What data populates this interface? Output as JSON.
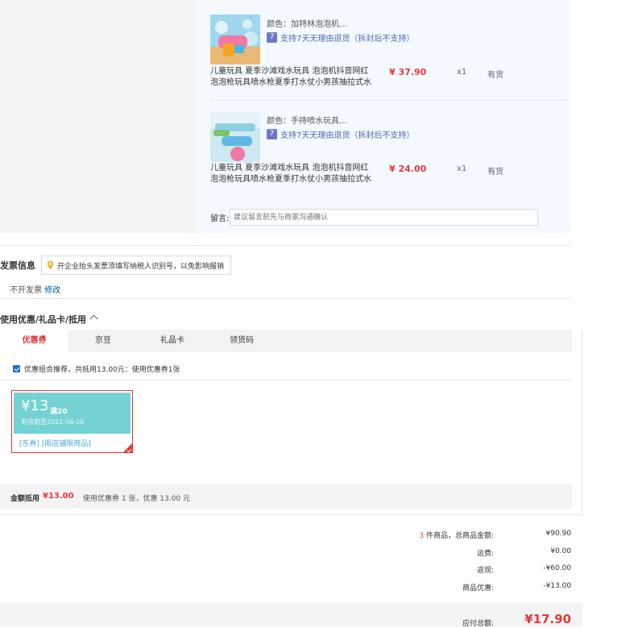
{
  "order_items": [
    {
      "attr": "颜色：加特林泡泡机...",
      "service": "支持7天无理由退货（拆封后不支持）",
      "title_line1": "儿童玩具 夏季沙滩戏水玩具 泡泡机抖音网红",
      "title_line2": "泡泡枪玩具喷水枪夏季打水仗小男孩抽拉式水",
      "price": "¥ 37.90",
      "qty": "x1",
      "stock": "有货"
    },
    {
      "attr": "颜色：手持喷水玩具...",
      "service": "支持7天无理由退货（拆封后不支持）",
      "title_line1": "儿童玩具 夏季沙滩戏水玩具 泡泡机抖音网红",
      "title_line2": "泡泡枪玩具喷水枪夏季打水仗小男孩抽拉式水",
      "price": "¥ 24.00",
      "qty": "x1",
      "stock": "有货"
    }
  ],
  "remark": {
    "label": "留言:",
    "placeholder": "建议留言前先与商家沟通确认"
  },
  "invoice": {
    "title": "发票信息",
    "tip": "开企业抬头发票须填写纳税人识别号，以免影响报销",
    "status": "不开发票",
    "edit": "修改"
  },
  "coupon_section": {
    "title": "使用优惠/礼品卡/抵用",
    "tabs": [
      "优惠券",
      "京豆",
      "礼品卡",
      "领货码"
    ],
    "combo_text": "优惠组合推荐，共抵用13.00元：使用优惠券1张",
    "coupon": {
      "amount": "¥13",
      "condition": "满20",
      "expiry": "有效期至2021-06-26",
      "tags": "[东券] [限店铺限商品]"
    },
    "offset_label": "金额抵用",
    "offset_amount": "¥13.00",
    "offset_desc": "使用优惠券 1 张，优惠 13.00 元"
  },
  "summary": {
    "count": "3",
    "count_suffix": " 件商品，总商品金额:",
    "goods_total": "¥90.90",
    "shipping_label": "运费:",
    "shipping": "¥0.00",
    "cashback_label": "返现:",
    "cashback": "-¥60.00",
    "discount_label": "商品优惠:",
    "discount": "-¥13.00",
    "total_label": "应付总额:",
    "total": "¥17.90"
  },
  "colors": {
    "accent_red": "#e4393c",
    "coupon_teal": "#74d2d4",
    "link_blue": "#005ea7",
    "panel_bg": "#f3f9fe"
  }
}
